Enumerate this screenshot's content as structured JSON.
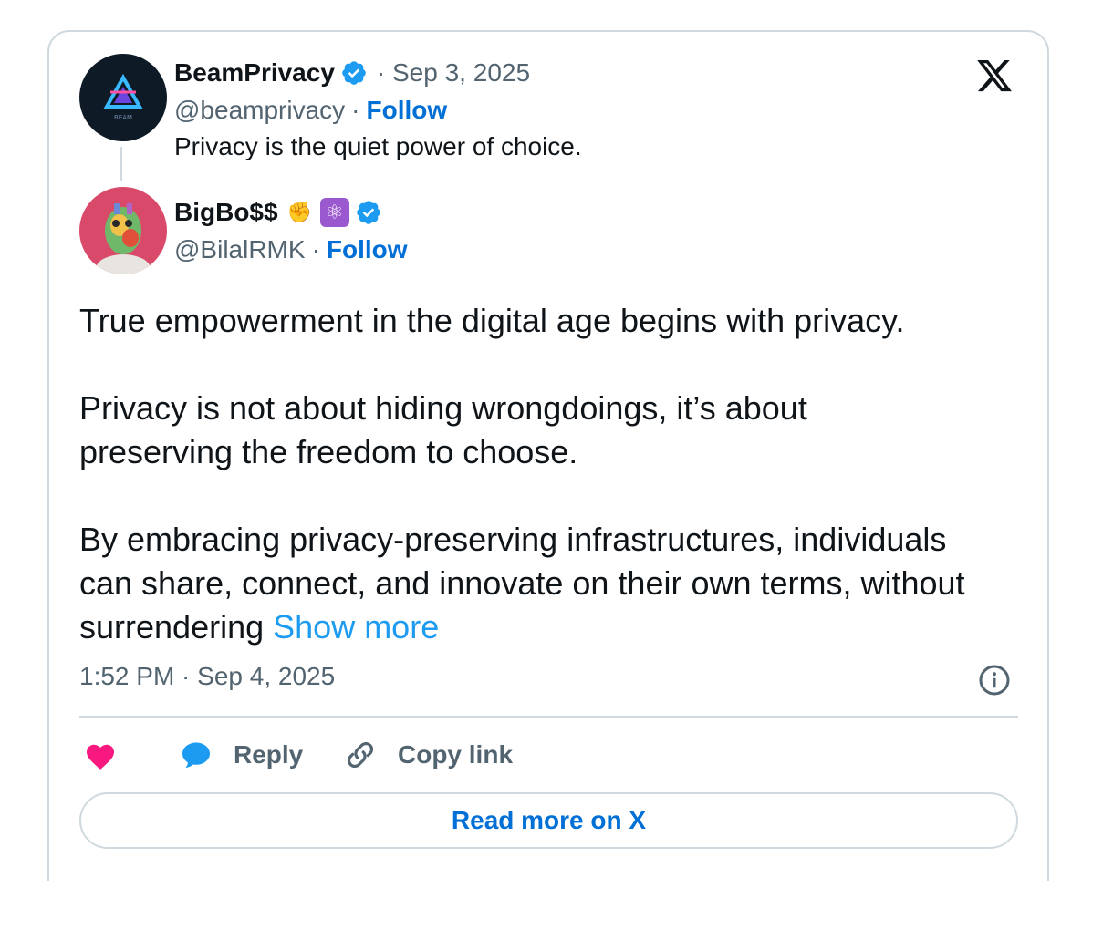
{
  "quoted": {
    "name": "BeamPrivacy",
    "date": "· Sep 3, 2025",
    "handle": "@beamprivacy",
    "separator": "·",
    "follow": "Follow",
    "text": "Privacy is the quiet power of choice.",
    "avatar_text": "BEAM"
  },
  "author": {
    "name": "BigBo$$",
    "emoji_1": "✊",
    "emoji_2": "⚛",
    "handle": "@BilalRMK",
    "separator": "·",
    "follow": "Follow"
  },
  "tweet": {
    "para1": "True empowerment in the digital age begins with privacy.",
    "para2": "Privacy is not about hiding wrongdoings, it’s about preserving the freedom to choose.",
    "para3": "By embracing privacy-preserving infrastructures, individuals can share, connect, and innovate on their own terms, without surrendering",
    "show_more": "Show more",
    "timestamp": "1:52 PM · Sep 4, 2025"
  },
  "actions": {
    "reply": "Reply",
    "copy_link": "Copy link",
    "read_more": "Read more on X"
  },
  "colors": {
    "verified": "#1d9bf0",
    "link": "#006fd6",
    "like": "#f91880",
    "reply_icon": "#1d9bf0",
    "muted": "#536471",
    "border": "#cfd9de"
  },
  "icons": [
    "verified-badge-icon",
    "x-logo-icon",
    "info-icon",
    "heart-icon",
    "reply-bubble-icon",
    "link-icon"
  ]
}
